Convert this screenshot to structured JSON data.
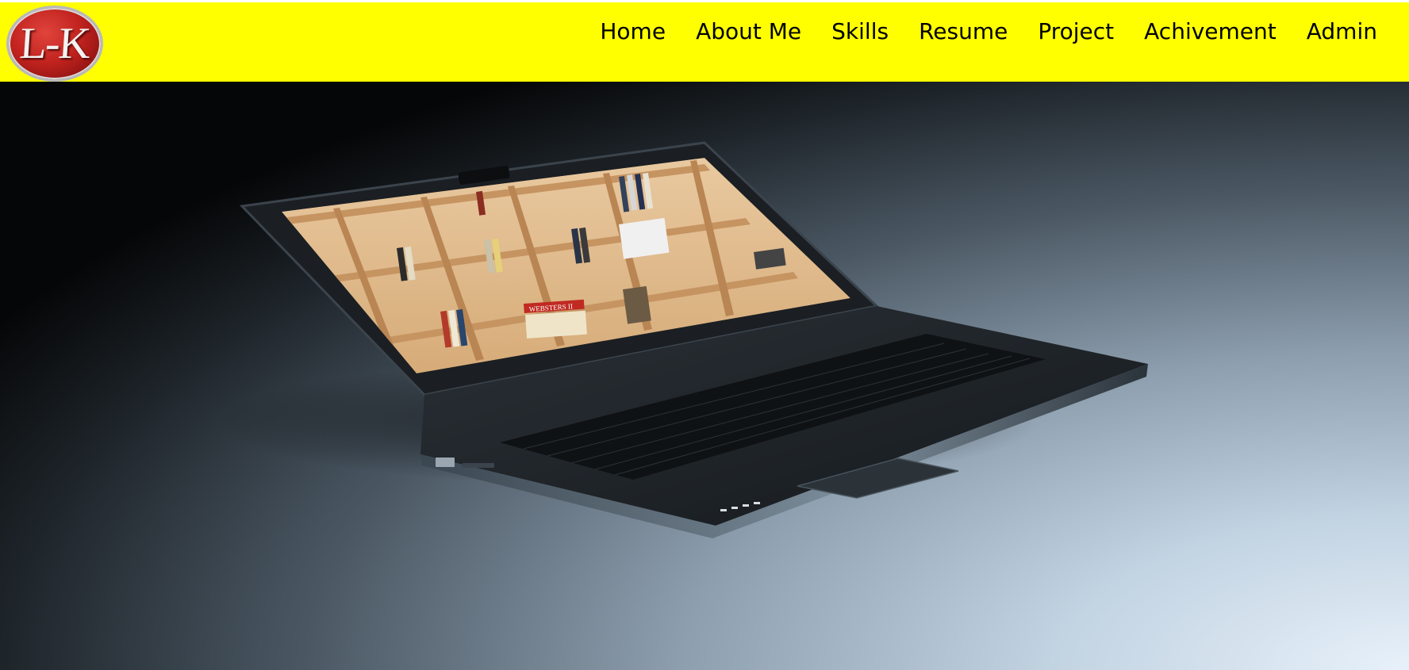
{
  "header": {
    "logo_text": "L-K",
    "background_color": "#ffff00"
  },
  "nav": {
    "items": [
      {
        "label": "Home"
      },
      {
        "label": "About Me"
      },
      {
        "label": "Skills"
      },
      {
        "label": "Resume"
      },
      {
        "label": "Project"
      },
      {
        "label": "Achivement"
      },
      {
        "label": "Admin"
      }
    ]
  },
  "hero": {
    "image_subject": "laptop-with-bookshelf-screen",
    "book_label": "WEBSTERS II"
  }
}
